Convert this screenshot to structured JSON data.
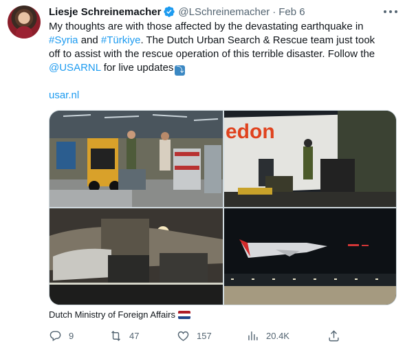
{
  "author": {
    "display_name": "Liesje Schreinemacher",
    "handle": "@LSchreinemacher",
    "separator": "·",
    "date": "Feb 6"
  },
  "tweet": {
    "line1": "My thoughts are with those affected by the devastating earthquake in",
    "line2_hashtag1": "#Syria",
    "line2_and": " and ",
    "line2_hashtag2": "#Türkiye",
    "line2_rest": ". The Dutch Urban Search & Rescue team just took",
    "line3": "off to assist with the rescue operation of this terrible disaster. Follow the",
    "line4_mention": "@USARNL",
    "line4_rest": " for live updates",
    "line4_emoji": "⤵",
    "url": "usar.nl"
  },
  "media": {
    "credit": "Dutch Ministry of Foreign Affairs",
    "photo_signs": {
      "plane_livery": "edon"
    }
  },
  "stats": {
    "replies": "9",
    "retweets": "47",
    "likes": "157",
    "views": "20.4K"
  },
  "colors": {
    "link": "#1d9bf0",
    "muted": "#536471",
    "verified": "#1d9bf0",
    "flag_red": "#ae1c28",
    "flag_white": "#ffffff",
    "flag_blue": "#21468b"
  },
  "icons": {
    "verified": "verified-badge-icon",
    "more": "more-horizontal-icon",
    "reply": "reply-icon",
    "retweet": "retweet-icon",
    "like": "heart-icon",
    "views": "analytics-icon",
    "share": "share-icon"
  }
}
